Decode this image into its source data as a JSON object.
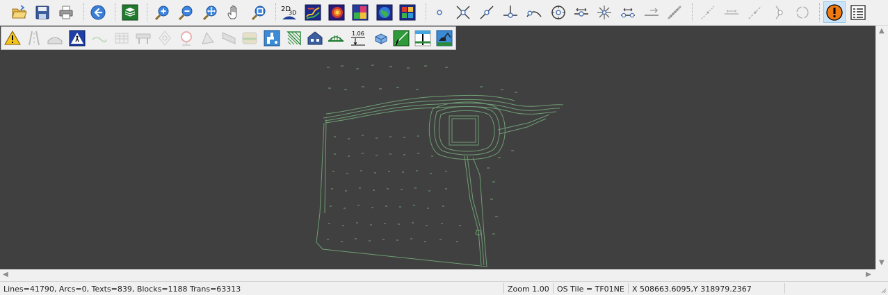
{
  "toolbar": {
    "icons": [
      "open-folder-icon",
      "save-disk-icon",
      "print-icon",
      "back-arrow-icon",
      "layers-icon",
      "zoom-in-icon",
      "zoom-out-icon",
      "zoom-extents-icon",
      "pan-hand-icon",
      "zoom-window-icon",
      "2d-3d-view-icon",
      "terrain-surface-icon",
      "contour-surface-icon",
      "slope-map-icon",
      "globe-icon",
      "point-cloud-icon",
      "snap-point-icon",
      "snap-intersection-icon",
      "snap-nearest-icon",
      "snap-perpendicular-icon",
      "snap-tangent-icon",
      "snap-centre-icon",
      "snap-midpoint-icon",
      "snap-node-icon",
      "snap-divide-icon",
      "snap-distance-icon",
      "snap-along-icon",
      "snap-line-icon",
      "snap-offset-icon",
      "snap-extension-icon",
      "snap-circle-icon",
      "snap-arc-centre-icon",
      "warning-alert-icon",
      "properties-list-icon"
    ],
    "label_2d": "2D",
    "label_3d": "3D"
  },
  "float_toolbar": {
    "icons": [
      "warning-sign-icon",
      "road-marking-icon",
      "kerb-icon",
      "pedestrian-crossing-icon",
      "drainage-icon",
      "fence-icon",
      "barrier-icon",
      "manhole-icon",
      "speed-sign-icon",
      "tree-icon",
      "wall-icon",
      "hedge-icon",
      "water-tap-icon",
      "hatch-area-icon",
      "building-icon",
      "bridge-icon",
      "level-marker-icon",
      "tank-icon",
      "gradient-icon",
      "section-icon",
      "excavator-icon"
    ],
    "level_value": "1.06"
  },
  "status": {
    "counts": "Lines=41790, Arcs=0, Texts=839, Blocks=1188 Trans=63313",
    "zoom": "Zoom 1.00",
    "os_tile": "OS Tile = TF01NE",
    "coords": "X 508663.6095,Y 318979.2367"
  },
  "colors": {
    "canvas_bg": "#404040",
    "survey_lines": "#6f9e74",
    "alert": "#f07a12"
  }
}
